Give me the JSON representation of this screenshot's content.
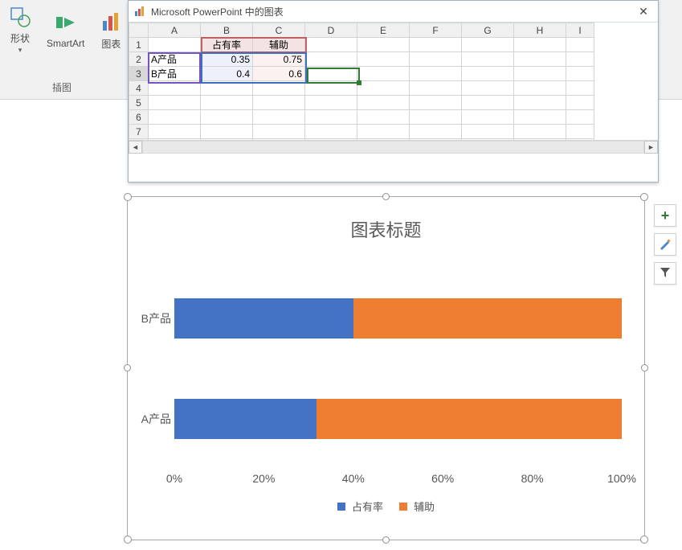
{
  "ribbon": {
    "group_label": "插图",
    "shapes_label": "形状",
    "smartart_label": "SmartArt",
    "chart_label": "图表"
  },
  "data_window": {
    "title": "Microsoft PowerPoint 中的图表",
    "col_headers": [
      "A",
      "B",
      "C",
      "D",
      "E",
      "F",
      "G",
      "H",
      "I"
    ],
    "row_headers": [
      "1",
      "2",
      "3",
      "4",
      "5",
      "6",
      "7"
    ],
    "cells": {
      "B1": "占有率",
      "C1": "辅助",
      "A2": "A产品",
      "B2": "0.35",
      "C2": "0.75",
      "A3": "B产品",
      "B3": "0.4",
      "C3": "0.6"
    },
    "selected_cell": "D3"
  },
  "chart_data": {
    "type": "bar",
    "title": "图表标题",
    "categories": [
      "A产品",
      "B产品"
    ],
    "series": [
      {
        "name": "占有率",
        "color": "#4472c4",
        "values": [
          0.35,
          0.4
        ]
      },
      {
        "name": "辅助",
        "color": "#ed7d31",
        "values": [
          0.75,
          0.6
        ]
      }
    ],
    "x_ticks": [
      "0%",
      "20%",
      "40%",
      "60%",
      "80%",
      "100%"
    ],
    "xlim": [
      0,
      1
    ],
    "xlabel": "",
    "ylabel": "",
    "stacked_percent": true
  },
  "side_buttons": {
    "add_tooltip": "+",
    "brush_tooltip": "✎",
    "filter_tooltip": "▼"
  }
}
